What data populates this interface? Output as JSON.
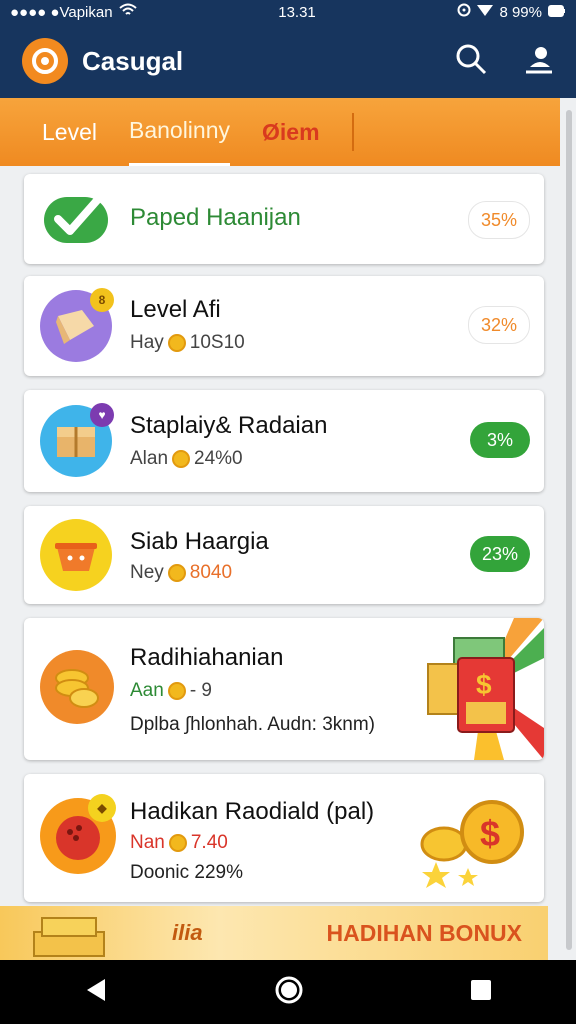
{
  "status_bar": {
    "carrier": "●●●● ●Vapikan",
    "time": "13.31",
    "battery": "8 99%"
  },
  "app": {
    "title": "Casugal"
  },
  "tabs": [
    {
      "label": "Level"
    },
    {
      "label": "Banolinny"
    },
    {
      "label": "Øiem"
    }
  ],
  "cards": [
    {
      "title": "Paped Haanijan",
      "subtitle": "",
      "percent": "35%"
    },
    {
      "title": "Level Afi",
      "subtitle_prefix": "Hay",
      "subtitle_value": "10S10",
      "percent": "32%",
      "icon_badge": "8"
    },
    {
      "title": "Staplaiy& Radaian",
      "subtitle_prefix": "Alan",
      "subtitle_value": "24%0",
      "percent": "3%"
    },
    {
      "title": "Siab Haargia",
      "subtitle_prefix": "Ney",
      "subtitle_value": "8040",
      "percent": "23%"
    },
    {
      "title": "Radihiahanian",
      "subtitle_prefix": "Aan",
      "subtitle_value": "- 9",
      "detail": "Dplba ∫hlonhah. Audn: 3knm)"
    },
    {
      "title": "Hadikan Raodiald (pal)",
      "subtitle_prefix": "Nan",
      "subtitle_value": "7.40",
      "detail": "Doonic 229%"
    }
  ],
  "bonus": {
    "label_left": "ilia",
    "label_right": "HADIHAN BONUX"
  },
  "colors": {
    "primary_dark": "#17355e",
    "accent_orange": "#f28a1f",
    "success_green": "#33a43a"
  }
}
